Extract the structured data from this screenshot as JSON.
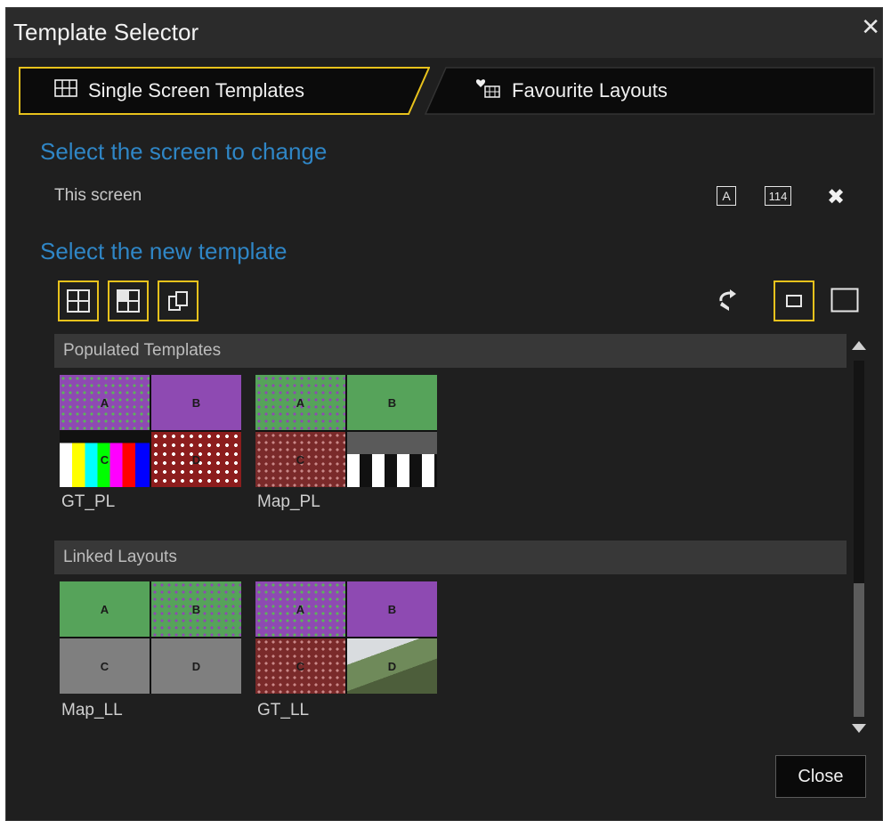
{
  "window": {
    "title": "Template Selector",
    "close_glyph": "✕"
  },
  "tabs": [
    {
      "label": "Single Screen Templates",
      "icon": "grid-icon",
      "active": true
    },
    {
      "label": "Favourite Layouts",
      "icon": "heart-grid-icon",
      "active": false
    }
  ],
  "select_screen": {
    "heading": "Select the screen to change",
    "screen_label": "This screen",
    "badge_a": "A",
    "badge_number": "114",
    "remove_glyph": "✖"
  },
  "select_template": {
    "heading": "Select the new template"
  },
  "groups": [
    {
      "title": "Populated Templates",
      "items": [
        {
          "label": "GT_PL",
          "cells": [
            "A",
            "B",
            "C",
            "D"
          ]
        },
        {
          "label": "Map_PL",
          "cells": [
            "A",
            "B",
            "C",
            ""
          ]
        }
      ]
    },
    {
      "title": "Linked Layouts",
      "items": [
        {
          "label": "Map_LL",
          "cells": [
            "A",
            "B",
            "C",
            "D"
          ]
        },
        {
          "label": "GT_LL",
          "cells": [
            "A",
            "B",
            "C",
            "D"
          ]
        }
      ]
    }
  ],
  "footer": {
    "close_label": "Close"
  },
  "colors": {
    "accent": "#e8c21c",
    "heading": "#2f86c6",
    "background": "#1f1f1f"
  }
}
